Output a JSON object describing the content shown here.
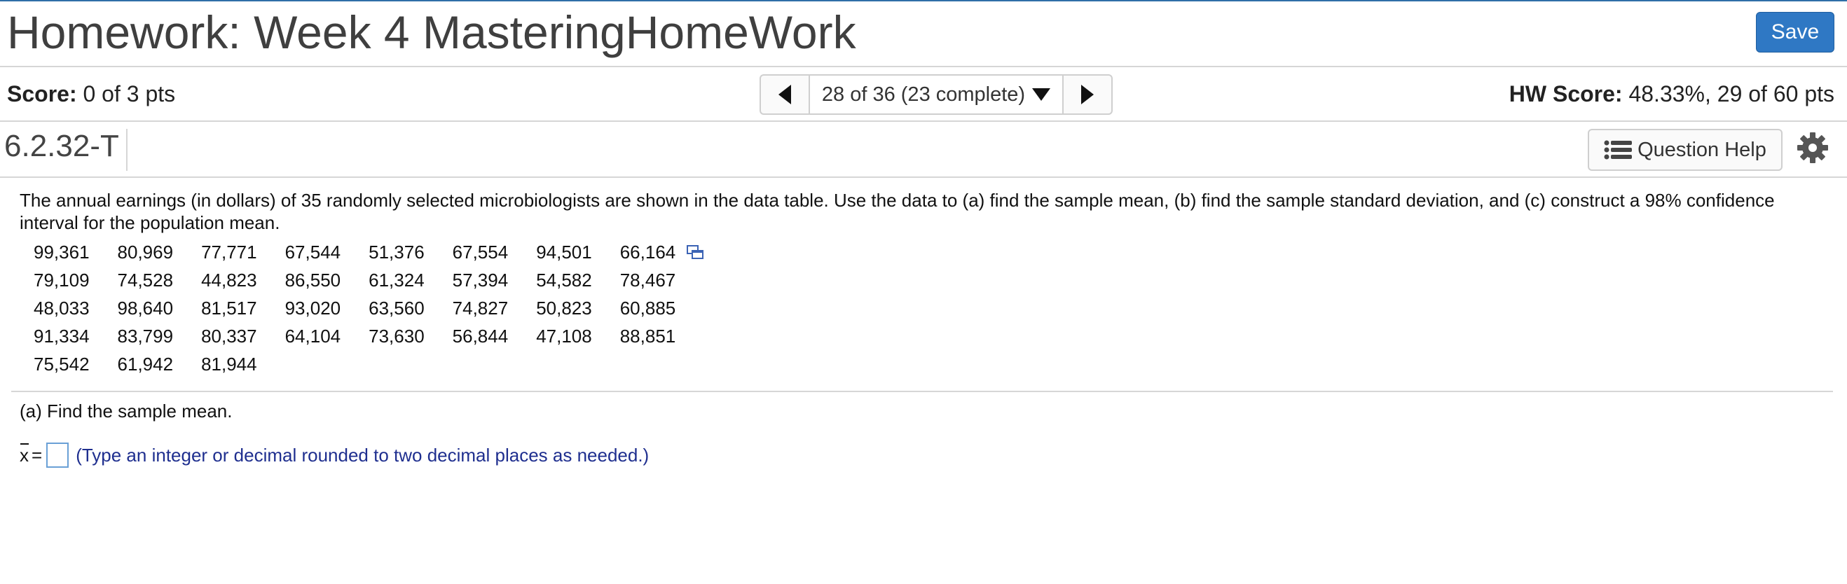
{
  "header": {
    "title": "Homework: Week 4 MasteringHomeWork",
    "save_label": "Save"
  },
  "scorebar": {
    "score_label": "Score:",
    "score_value": "0 of 3 pts",
    "nav_text": "28 of 36 (23 complete)",
    "hw_score_label": "HW Score:",
    "hw_score_value": "48.33%, 29 of 60 pts"
  },
  "question": {
    "id": "6.2.32-T",
    "help_label": "Question Help",
    "prompt": "The annual earnings (in dollars) of 35 randomly selected microbiologists are shown in the data table. Use the data to (a) find the sample mean, (b) find the sample standard deviation, and (c) construct a 98% confidence interval for the population mean.",
    "data_rows": [
      [
        "99,361",
        "80,969",
        "77,771",
        "67,544",
        "51,376",
        "67,554",
        "94,501",
        "66,164"
      ],
      [
        "79,109",
        "74,528",
        "44,823",
        "86,550",
        "61,324",
        "57,394",
        "54,582",
        "78,467"
      ],
      [
        "48,033",
        "98,640",
        "81,517",
        "93,020",
        "63,560",
        "74,827",
        "50,823",
        "60,885"
      ],
      [
        "91,334",
        "83,799",
        "80,337",
        "64,104",
        "73,630",
        "56,844",
        "47,108",
        "88,851"
      ],
      [
        "75,542",
        "61,942",
        "81,944",
        "",
        "",
        "",
        "",
        ""
      ]
    ],
    "part_a": "(a) Find the sample mean.",
    "answer_symbol": "x",
    "answer_equals": "=",
    "answer_value": "",
    "answer_hint": "(Type an integer or decimal rounded to two decimal places as needed.)"
  },
  "colors": {
    "save_button": "#2f78c4",
    "hint_text": "#1f2f8f",
    "top_border": "#2f6fa8"
  },
  "icons": [
    "chevron-left-icon",
    "chevron-down-icon",
    "chevron-right-icon",
    "list-icon",
    "gear-icon",
    "data-popup-icon"
  ]
}
